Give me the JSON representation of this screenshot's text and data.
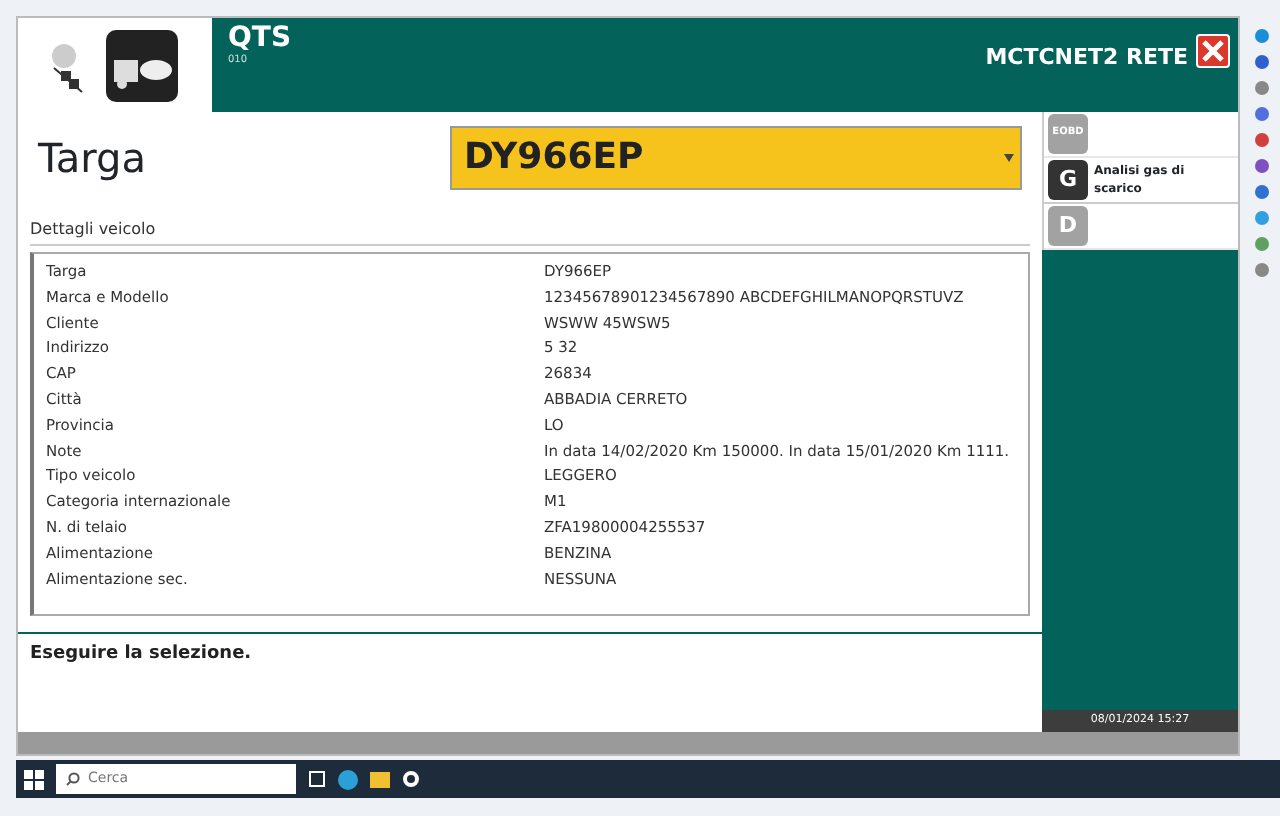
{
  "header": {
    "title": "QTS",
    "version": "010",
    "network": "MCTCNET2 RETE"
  },
  "plate": {
    "label": "Targa",
    "value": "DY966EP"
  },
  "details": {
    "title": "Dettagli veicolo",
    "rows": [
      {
        "label": "Targa",
        "value": "DY966EP"
      },
      {
        "label": "Marca e Modello",
        "value": "12345678901234567890 ABCDEFGHILMANOPQRSTUVZ"
      },
      {
        "label": "Cliente",
        "value": "WSWW 45WSW5"
      },
      {
        "label": "Indirizzo",
        "value": "5 32"
      },
      {
        "label": "CAP",
        "value": "26834"
      },
      {
        "label": "Città",
        "value": "ABBADIA CERRETO"
      },
      {
        "label": "Provincia",
        "value": "LO"
      },
      {
        "label": "Note",
        "value": "In data 14/02/2020 Km 150000. In data 15/01/2020 Km 1111."
      },
      {
        "label": "Tipo veicolo",
        "value": "LEGGERO"
      },
      {
        "label": "Categoria internazionale",
        "value": "M1"
      },
      {
        "label": "N. di telaio",
        "value": "ZFA19800004255537"
      },
      {
        "label": "Alimentazione",
        "value": "BENZINA"
      },
      {
        "label": "Alimentazione sec.",
        "value": "NESSUNA"
      }
    ]
  },
  "message": "Eseguire la selezione.",
  "menu": [
    {
      "icon": "EOBD",
      "disabled": true
    },
    {
      "icon": "G",
      "label": "Analisi gas di scarico",
      "disabled": false
    },
    {
      "icon": "D",
      "disabled": true
    }
  ],
  "status_datetime": "08/01/2024 15:27",
  "taskbar": {
    "search_placeholder": "Cerca"
  }
}
